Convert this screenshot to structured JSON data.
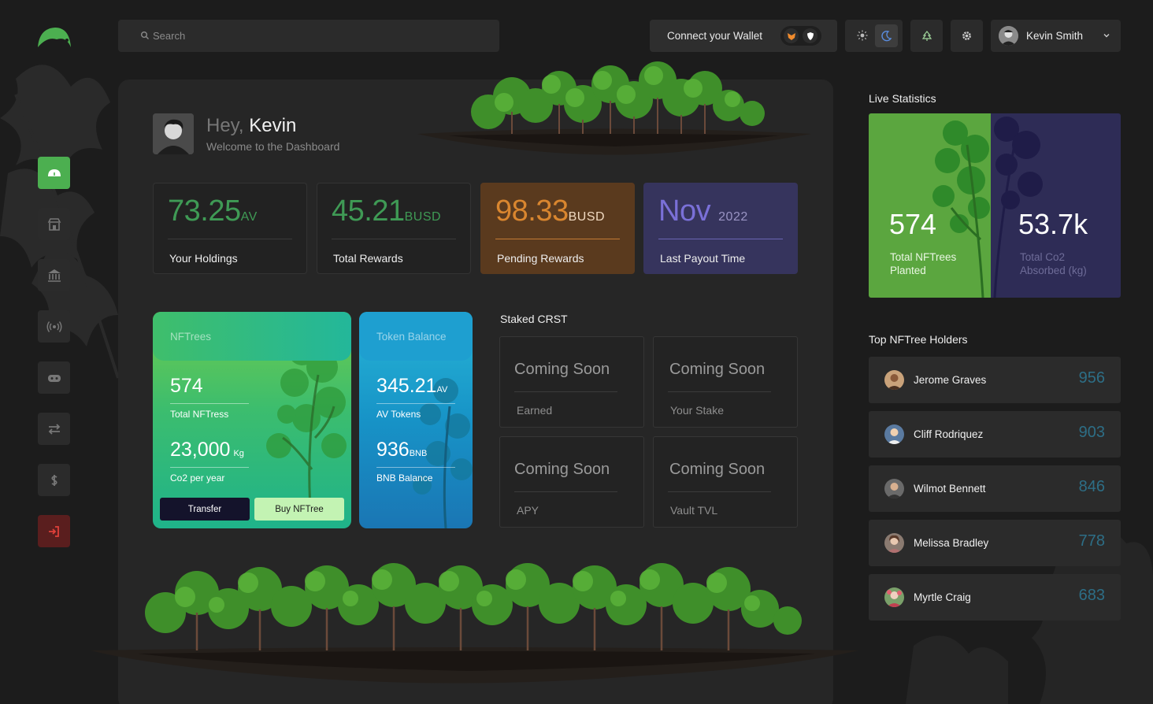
{
  "search": {
    "placeholder": "Search"
  },
  "header": {
    "wallet_label": "Connect your Wallet",
    "user_name": "Kevin Smith"
  },
  "greeting": {
    "hey": "Hey,",
    "name": "Kevin",
    "subtitle": "Welcome to the Dashboard"
  },
  "stats": [
    {
      "value": "73.25",
      "unit": "AV",
      "label": "Your Holdings",
      "color": "#3f9a55"
    },
    {
      "value": "45.21",
      "unit": "BUSD",
      "label": "Total Rewards",
      "color": "#3f9a55"
    },
    {
      "value": "98.33",
      "unit": "BUSD",
      "label": "Pending Rewards",
      "color": "#c97a2b"
    },
    {
      "value": "Nov",
      "unit": "2022",
      "label": "Last Payout Time",
      "color": "#6a62c4"
    }
  ],
  "nftrees_card": {
    "title": "NFTrees",
    "total_value": "574",
    "total_label": "Total NFTress",
    "co2_value": "23,000",
    "co2_unit": "Kg",
    "co2_label": "Co2 per year",
    "transfer_label": "Transfer",
    "buy_label": "Buy NFTree"
  },
  "token_card": {
    "title": "Token Balance",
    "av_value": "345.21",
    "av_unit": "AV",
    "av_label": "AV Tokens",
    "bnb_value": "936",
    "bnb_unit": "BNB",
    "bnb_label": "BNB Balance"
  },
  "staked": {
    "title": "Staked CRST",
    "items": [
      {
        "value": "Coming Soon",
        "label": "Earned"
      },
      {
        "value": "Coming Soon",
        "label": "Your Stake"
      },
      {
        "value": "Coming Soon",
        "label": "APY"
      },
      {
        "value": "Coming Soon",
        "label": "Vault TVL"
      }
    ]
  },
  "live_stats": {
    "title": "Live Statistics",
    "left_value": "574",
    "left_label_1": "Total NFTrees",
    "left_label_2": "Planted",
    "right_value": "53.7k",
    "right_label_1": "Total Co2",
    "right_label_2": "Absorbed (kg)"
  },
  "holders": {
    "title": "Top NFTree Holders",
    "items": [
      {
        "name": "Jerome Graves",
        "score": "956"
      },
      {
        "name": "Cliff Rodriquez",
        "score": "903"
      },
      {
        "name": "Wilmot Bennett",
        "score": "846"
      },
      {
        "name": "Melissa Bradley",
        "score": "778"
      },
      {
        "name": "Myrtle Craig",
        "score": "683"
      }
    ]
  },
  "sidebar": {
    "items": [
      {
        "icon": "dashboard-icon"
      },
      {
        "icon": "store-icon"
      },
      {
        "icon": "bank-icon"
      },
      {
        "icon": "broadcast-icon"
      },
      {
        "icon": "gamepad-icon"
      },
      {
        "icon": "swap-icon"
      },
      {
        "icon": "dollar-icon"
      },
      {
        "icon": "logout-icon"
      }
    ]
  }
}
